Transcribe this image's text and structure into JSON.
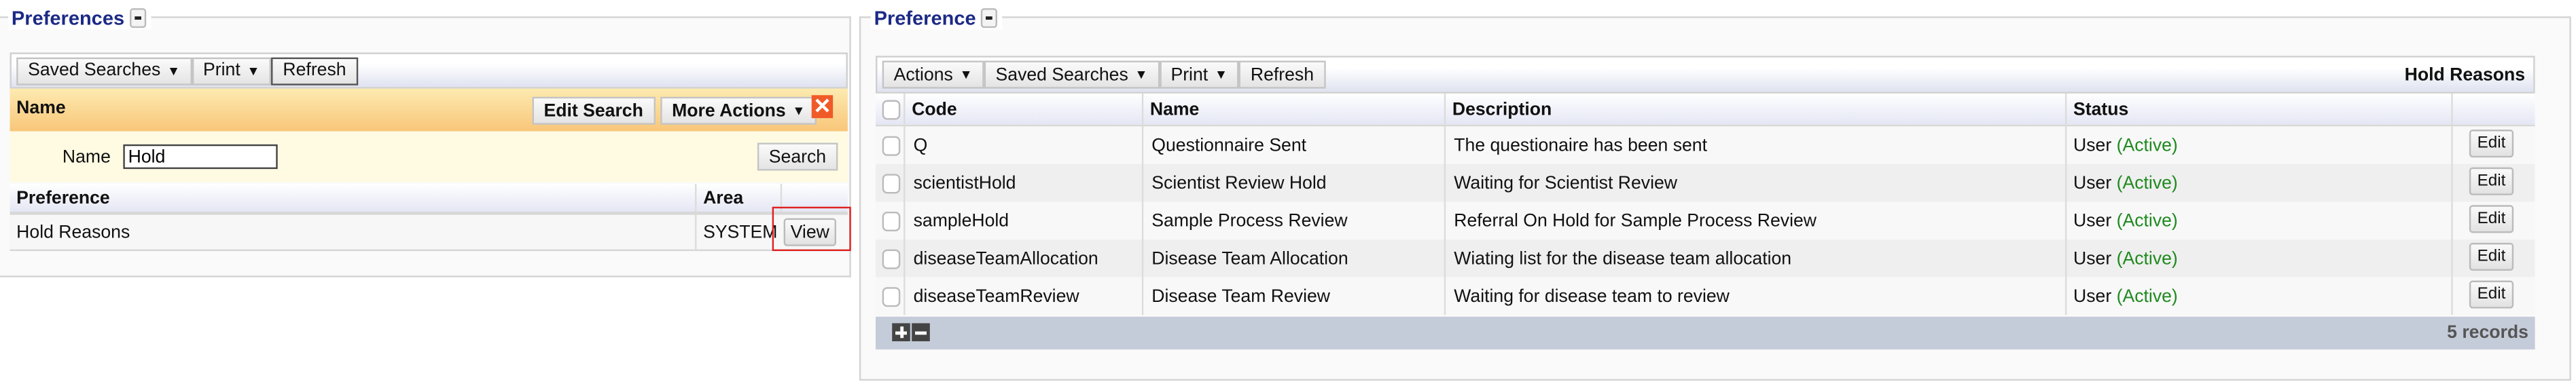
{
  "left": {
    "legend": "Preferences",
    "toolbar": {
      "saved_searches": "Saved Searches",
      "print": "Print",
      "refresh": "Refresh"
    },
    "search_header": {
      "title": "Name",
      "edit_search": "Edit Search",
      "more_actions": "More Actions"
    },
    "search_form": {
      "name_label": "Name",
      "name_value": "Hold",
      "search_button": "Search"
    },
    "table": {
      "columns": [
        "Preference",
        "Area",
        ""
      ],
      "rows": [
        {
          "preference": "Hold Reasons",
          "area": "SYSTEM",
          "action": "View"
        }
      ]
    }
  },
  "right": {
    "legend": "Preference",
    "toolbar": {
      "actions": "Actions",
      "saved_searches": "Saved Searches",
      "print": "Print",
      "refresh": "Refresh",
      "title": "Hold Reasons"
    },
    "table": {
      "columns": [
        "Code",
        "Name",
        "Description",
        "Status",
        ""
      ],
      "rows": [
        {
          "code": "Q",
          "name": "Questionnaire Sent",
          "description": "The questionaire has been sent",
          "status_type": "User",
          "status": "(Active)",
          "action": "Edit"
        },
        {
          "code": "scientistHold",
          "name": "Scientist Review Hold",
          "description": "Waiting for Scientist Review",
          "status_type": "User",
          "status": "(Active)",
          "action": "Edit"
        },
        {
          "code": "sampleHold",
          "name": "Sample Process Review",
          "description": "Referral On Hold for Sample Process Review",
          "status_type": "User",
          "status": "(Active)",
          "action": "Edit"
        },
        {
          "code": "diseaseTeamAllocation",
          "name": "Disease Team Allocation",
          "description": "Wiating list for the disease team allocation",
          "status_type": "User",
          "status": "(Active)",
          "action": "Edit"
        },
        {
          "code": "diseaseTeamReview",
          "name": "Disease Team Review",
          "description": "Waiting for disease team to review",
          "status_type": "User",
          "status": "(Active)",
          "action": "Edit"
        }
      ],
      "footer": {
        "record_count": "5 records"
      }
    }
  },
  "colors": {
    "legend": "#1c2a86",
    "active": "#1f8a1f",
    "highlight": "#e02020",
    "footer": "#c5ccd9"
  }
}
